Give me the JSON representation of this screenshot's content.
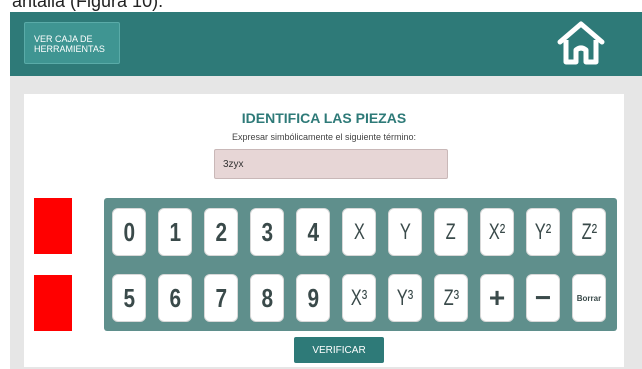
{
  "caption": "antalla (Figura 10).",
  "header": {
    "toolbox_label": "VER CAJA DE\nHERRAMIENTAS",
    "home_icon": "home-icon"
  },
  "exercise": {
    "title": "IDENTIFICA LAS PIEZAS",
    "instruction": "Expresar simbólicamente el siguiente término:",
    "answer_value": "3zyx"
  },
  "keypad": {
    "row1": [
      "0",
      "1",
      "2",
      "3",
      "4",
      "X",
      "Y",
      "Z",
      "X²",
      "Y²",
      "Z²"
    ],
    "row2": [
      "5",
      "6",
      "7",
      "8",
      "9",
      "X³",
      "Y³",
      "Z³",
      "+",
      "−",
      "Borrar"
    ]
  },
  "verify_label": "VERIFICAR",
  "colors": {
    "header_bg": "#2e7a78",
    "accent": "#2e7a78",
    "keypad_bg": "#5f8f8c",
    "indicator": "#ff0000",
    "answer_bg": "#e7d6d6"
  }
}
